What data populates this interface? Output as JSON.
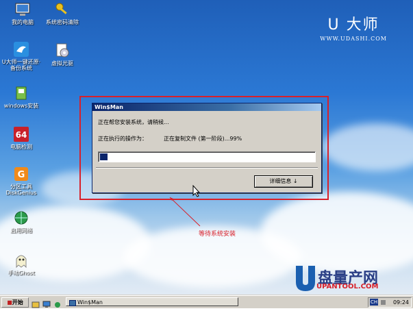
{
  "desktop": {
    "icons": [
      {
        "label": "我的电脑",
        "icon": "computer-icon"
      },
      {
        "label": "系统密码清除",
        "icon": "key-icon"
      },
      {
        "label": "U大师一键还原·备份系统",
        "icon": "bird-icon"
      },
      {
        "label": "虚拟光驱",
        "icon": "cd-drive-icon"
      },
      {
        "label": "windows安装",
        "icon": "installer-icon"
      },
      {
        "label": "电脑检测",
        "icon": "cpu-64-icon"
      },
      {
        "label": "分区工具DiskGenius",
        "icon": "disk-tool-icon"
      },
      {
        "label": "启用网络",
        "icon": "globe-icon"
      },
      {
        "label": "手动Ghost",
        "icon": "ghost-icon"
      }
    ],
    "brand": {
      "logo": "U 大师",
      "url": "WWW.UDASHI.COM"
    }
  },
  "dialog": {
    "title": "Win$Man",
    "message": "正在帮您安装系统，请稍候...",
    "operation_label": "正在执行的操作为：",
    "operation_value": "正在复制文件 (第一阶段)...99%",
    "progress_percent": 4,
    "details_button": "详细信息 ↓"
  },
  "annotation": {
    "text": "等待系统安装",
    "color": "#d8202a"
  },
  "watermark": {
    "name": "盘量产网",
    "url": "UPANTOOL.COM"
  },
  "taskbar": {
    "start_label": "开始",
    "task_label": "Win$Man",
    "lang": "CH",
    "clock": "09:24"
  },
  "colors": {
    "accent_red": "#d8202a",
    "title_blue": "#0a246a"
  }
}
